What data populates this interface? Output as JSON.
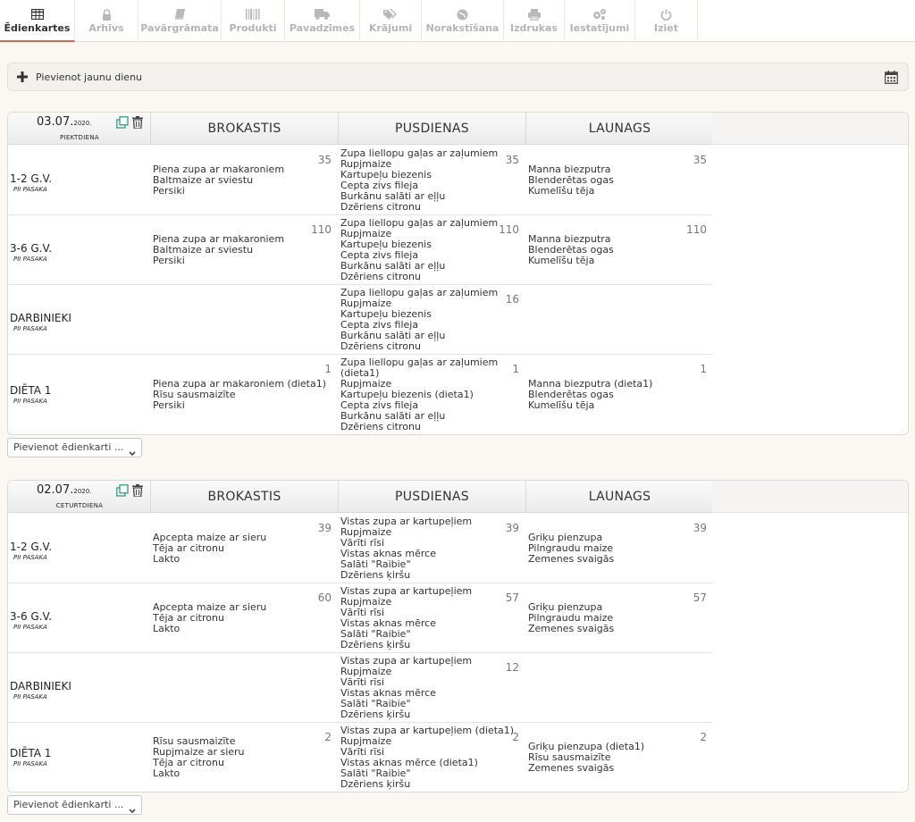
{
  "nav": [
    {
      "label": "Ēdienkartes",
      "icon": "table-icon",
      "active": true
    },
    {
      "label": "Arhīvs",
      "icon": "lock-icon"
    },
    {
      "label": "Pavārgrāmata",
      "icon": "book-icon"
    },
    {
      "label": "Produkti",
      "icon": "barcode-icon"
    },
    {
      "label": "Pavadzīmes",
      "icon": "truck-icon"
    },
    {
      "label": "Krājumi",
      "icon": "tags-icon"
    },
    {
      "label": "Norakstīšana",
      "icon": "globe-icon"
    },
    {
      "label": "Izdrukas",
      "icon": "printer-icon"
    },
    {
      "label": "Iestatījumi",
      "icon": "gears-icon"
    },
    {
      "label": "Iziet",
      "icon": "power-icon"
    }
  ],
  "add_day": {
    "label": "Pievienot jaunu dienu"
  },
  "days": [
    {
      "date": "03.07.",
      "year": "2020.",
      "weekday": "PIEKTDIENA",
      "meals": [
        "BROKASTIS",
        "PUSDIENAS",
        "LAUNAGS"
      ],
      "select_placeholder": "Pievienot ēdienkarti ...",
      "rows": [
        {
          "group": "1-2 G.V.",
          "sub": "PII PASAKA",
          "cells": [
            {
              "count": "35",
              "items": [
                "Piena zupa ar makaroniem",
                "Baltmaize ar sviestu",
                "Persiki"
              ]
            },
            {
              "count": "35",
              "items": [
                "Zupa liellopu gaļas ar zaļumiem",
                "Rupjmaize",
                "Kartupeļu biezenis",
                "Cepta zivs fileja",
                "Burkānu salāti ar eļļu",
                "Dzēriens citronu"
              ]
            },
            {
              "count": "35",
              "items": [
                "Manna biezputra",
                "Blenderētas ogas",
                "Kumelīšu tēja"
              ]
            }
          ]
        },
        {
          "group": "3-6 G.V.",
          "sub": "PII PASAKA",
          "cells": [
            {
              "count": "110",
              "items": [
                "Piena zupa ar makaroniem",
                "Baltmaize ar sviestu",
                "Persiki"
              ]
            },
            {
              "count": "110",
              "items": [
                "Zupa liellopu gaļas ar zaļumiem",
                "Rupjmaize",
                "Kartupeļu biezenis",
                "Cepta zivs fileja",
                "Burkānu salāti ar eļļu",
                "Dzēriens citronu"
              ]
            },
            {
              "count": "110",
              "items": [
                "Manna biezputra",
                "Blenderētas ogas",
                "Kumelīšu tēja"
              ]
            }
          ]
        },
        {
          "group": "DARBINIEKI",
          "sub": "PII PASAKA",
          "cells": [
            {
              "count": "",
              "items": []
            },
            {
              "count": "16",
              "items": [
                "Zupa liellopu gaļas ar zaļumiem",
                "Rupjmaize",
                "Kartupeļu biezenis",
                "Cepta zivs fileja",
                "Burkānu salāti ar eļļu",
                "Dzēriens citronu"
              ]
            },
            {
              "count": "",
              "items": []
            }
          ]
        },
        {
          "group": "DIĒTA 1",
          "sub": "PII PASAKA",
          "cells": [
            {
              "count": "1",
              "items": [
                "Piena zupa ar makaroniem (dieta1)",
                "Rīsu sausmaizīte",
                "Persiki"
              ]
            },
            {
              "count": "1",
              "items": [
                "Zupa liellopu gaļas ar zaļumiem",
                "(dieta1)",
                "Rupjmaize",
                "Kartupeļu biezenis (dieta1)",
                "Cepta zivs fileja",
                "Burkānu salāti ar eļļu",
                "Dzēriens citronu"
              ]
            },
            {
              "count": "1",
              "items": [
                "Manna biezputra (dieta1)",
                "Blenderētas ogas",
                "Kumelīšu tēja"
              ]
            }
          ]
        }
      ]
    },
    {
      "date": "02.07.",
      "year": "2020.",
      "weekday": "CETURTDIENA",
      "meals": [
        "BROKASTIS",
        "PUSDIENAS",
        "LAUNAGS"
      ],
      "select_placeholder": "Pievienot ēdienkarti ...",
      "rows": [
        {
          "group": "1-2 G.V.",
          "sub": "PII PASAKA",
          "cells": [
            {
              "count": "39",
              "items": [
                "Apcepta maize ar sieru",
                "Tēja ar citronu",
                "Lakto"
              ]
            },
            {
              "count": "39",
              "items": [
                "Vistas zupa ar kartupeļiem",
                "Rupjmaize",
                "Vārīti rīsi",
                "Vistas aknas mērce",
                "Salāti \"Raibie\"",
                "Dzēriens ķiršu"
              ]
            },
            {
              "count": "39",
              "items": [
                "Griķu pienzupa",
                "Pilngraudu maize",
                "Zemenes svaigās"
              ]
            }
          ]
        },
        {
          "group": "3-6 G.V.",
          "sub": "PII PASAKA",
          "cells": [
            {
              "count": "60",
              "items": [
                "Apcepta maize ar sieru",
                "Tēja ar citronu",
                "Lakto"
              ]
            },
            {
              "count": "57",
              "items": [
                "Vistas zupa ar kartupeļiem",
                "Rupjmaize",
                "Vārīti rīsi",
                "Vistas aknas mērce",
                "Salāti \"Raibie\"",
                "Dzēriens ķiršu"
              ]
            },
            {
              "count": "57",
              "items": [
                "Griķu pienzupa",
                "Pilngraudu maize",
                "Zemenes svaigās"
              ]
            }
          ]
        },
        {
          "group": "DARBINIEKI",
          "sub": "PII PASAKA",
          "cells": [
            {
              "count": "",
              "items": []
            },
            {
              "count": "12",
              "items": [
                "Vistas zupa ar kartupeļiem",
                "Rupjmaize",
                "Vārīti rīsi",
                "Vistas aknas mērce",
                "Salāti \"Raibie\"",
                "Dzēriens ķiršu"
              ]
            },
            {
              "count": "",
              "items": []
            }
          ]
        },
        {
          "group": "DIĒTA 1",
          "sub": "PII PASAKA",
          "cells": [
            {
              "count": "2",
              "items": [
                "Rīsu sausmaizīte",
                "Rupjmaize ar sieru",
                "Tēja ar citronu",
                "Lakto"
              ]
            },
            {
              "count": "2",
              "items": [
                "Vistas zupa ar kartupeļiem (dieta1)",
                "Rupjmaize",
                "Vārīti rīsi",
                "Vistas aknas mērce (dieta1)",
                "Salāti \"Raibie\"",
                "Dzēriens ķiršu"
              ]
            },
            {
              "count": "2",
              "items": [
                "Griķu pienzupa (dieta1)",
                "Rīsu sausmaizīte",
                "Zemenes svaigās"
              ]
            }
          ]
        }
      ]
    }
  ]
}
